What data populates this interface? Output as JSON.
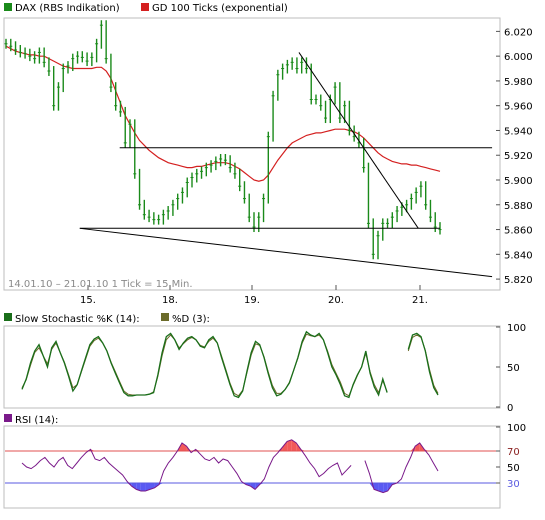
{
  "legend": {
    "price_label": "DAX (RBS Indikation)",
    "ma_label": "GD 100 Ticks (exponential)",
    "price_color": "#1a8a1a",
    "ma_color": "#d42020",
    "stoch_k_label": "Slow Stochastic %K (14):",
    "stoch_d_label": "%D (3):",
    "stoch_k_color": "#1a6e1a",
    "stoch_d_color": "#6b6b2a",
    "rsi_label": "RSI (14):",
    "rsi_color": "#7a1a8a"
  },
  "period_note": "14.01.10 – 21.01.10   1 Tick = 15 Min.",
  "chart_data": [
    {
      "type": "line",
      "title": "",
      "series": [
        {
          "name": "DAX (RBS Indikation)",
          "style": "bar-ticks",
          "values": [
            6010,
            6008,
            6005,
            6003,
            6002,
            6000,
            5998,
            6003,
            5995,
            5988,
            5960,
            5975,
            5990,
            5992,
            5998,
            6000,
            5999,
            5996,
            5999,
            6010,
            6025,
            5998,
            5975,
            5960,
            5955,
            5930,
            5945,
            5905,
            5880,
            5872,
            5870,
            5868,
            5868,
            5872,
            5875,
            5880,
            5885,
            5890,
            5898,
            5902,
            5905,
            5907,
            5910,
            5912,
            5915,
            5917,
            5916,
            5910,
            5905,
            5895,
            5885,
            5870,
            5862,
            5870,
            5885,
            5935,
            5968,
            5985,
            5990,
            5993,
            5995,
            5990,
            5995,
            5990,
            5965,
            5965,
            5960,
            5950,
            5965,
            5975,
            5950,
            5960,
            5940,
            5935,
            5930,
            5910,
            5865,
            5840,
            5855,
            5865,
            5865,
            5870,
            5875,
            5878,
            5880,
            5885,
            5890,
            5895,
            5880,
            5870,
            5862,
            5860
          ],
          "ylim": [
            5812,
            6030
          ]
        },
        {
          "name": "GD 100 Ticks (exponential)",
          "style": "line",
          "values": [
            6008,
            6006,
            6004,
            6003,
            6002,
            6001,
            6001,
            6000,
            6000,
            5998,
            5996,
            5994,
            5992,
            5991,
            5990,
            5990,
            5990,
            5990,
            5990,
            5991,
            5991,
            5988,
            5982,
            5972,
            5962,
            5952,
            5945,
            5938,
            5932,
            5928,
            5924,
            5921,
            5918,
            5916,
            5914,
            5913,
            5912,
            5911,
            5910,
            5910,
            5911,
            5911,
            5912,
            5913,
            5914,
            5914,
            5914,
            5913,
            5911,
            5909,
            5906,
            5903,
            5900,
            5899,
            5900,
            5904,
            5910,
            5916,
            5921,
            5926,
            5930,
            5932,
            5934,
            5936,
            5937,
            5938,
            5938,
            5939,
            5940,
            5941,
            5941,
            5941,
            5940,
            5939,
            5937,
            5934,
            5930,
            5926,
            5922,
            5919,
            5917,
            5915,
            5914,
            5913,
            5913,
            5912,
            5912,
            5911,
            5910,
            5909,
            5908,
            5907
          ]
        }
      ],
      "trendlines": [
        {
          "from": [
            0.17,
            5861
          ],
          "to": [
            1.12,
            5822
          ]
        },
        {
          "from": [
            0.17,
            5861
          ],
          "to": [
            1.0,
            5861
          ]
        },
        {
          "from": [
            0.262,
            5926
          ],
          "to": [
            1.12,
            5926
          ]
        },
        {
          "from": [
            0.675,
            6003
          ],
          "to": [
            0.95,
            5861
          ]
        }
      ],
      "x_ticks": [
        "15.",
        "18.",
        "19.",
        "20.",
        "21."
      ],
      "y_ticks": [
        5820,
        5840,
        5860,
        5880,
        5900,
        5920,
        5940,
        5960,
        5980,
        6000,
        6020
      ],
      "y_tick_labels": [
        "5.820",
        "5.840",
        "5.860",
        "5.880",
        "5.900",
        "5.920",
        "5.940",
        "5.960",
        "5.980",
        "6.000",
        "6.020"
      ],
      "ylim": [
        5812,
        6030
      ],
      "grid": false
    },
    {
      "type": "line",
      "series": [
        {
          "name": "Slow Stochastic %K (14):",
          "values": [
            22,
            35,
            55,
            70,
            78,
            64,
            50,
            74,
            82,
            68,
            55,
            38,
            20,
            28,
            45,
            62,
            78,
            85,
            88,
            80,
            70,
            55,
            42,
            30,
            18,
            14,
            14,
            15,
            15,
            15,
            16,
            18,
            40,
            68,
            88,
            92,
            84,
            72,
            80,
            86,
            88,
            84,
            76,
            74,
            84,
            88,
            80,
            62,
            45,
            28,
            14,
            12,
            20,
            45,
            68,
            82,
            78,
            62,
            42,
            24,
            14,
            16,
            22,
            30,
            46,
            62,
            82,
            94,
            90,
            88,
            92,
            84,
            68,
            50,
            40,
            28,
            14,
            12,
            28,
            40,
            50,
            70,
            42,
            25,
            15,
            35,
            18,
            12,
            18,
            32,
            45,
            72,
            90,
            92,
            88,
            70,
            44,
            24,
            15
          ],
          "gaps": [
            87,
            88,
            89,
            90
          ]
        },
        {
          "name": "%D (3):",
          "values": [
            24,
            34,
            52,
            68,
            74,
            64,
            54,
            72,
            80,
            68,
            56,
            40,
            24,
            28,
            44,
            60,
            76,
            83,
            86,
            80,
            70,
            56,
            44,
            32,
            20,
            16,
            15,
            15,
            15,
            15,
            16,
            19,
            38,
            64,
            84,
            90,
            84,
            74,
            79,
            84,
            87,
            84,
            77,
            75,
            82,
            86,
            80,
            64,
            47,
            30,
            17,
            14,
            21,
            43,
            65,
            79,
            77,
            63,
            44,
            27,
            17,
            17,
            22,
            31,
            46,
            61,
            80,
            91,
            89,
            88,
            90,
            84,
            70,
            53,
            42,
            31,
            17,
            14,
            27,
            39,
            50,
            67,
            44,
            28,
            18,
            33,
            19,
            14,
            19,
            32,
            45,
            70,
            87,
            90,
            87,
            71,
            47,
            27,
            17
          ],
          "gaps": [
            87,
            88,
            89,
            90
          ]
        }
      ],
      "y_ticks": [
        0,
        50,
        100
      ],
      "ylim": [
        0,
        100
      ],
      "grid": false
    },
    {
      "type": "line",
      "series": [
        {
          "name": "RSI (14):",
          "values": [
            55,
            50,
            48,
            52,
            58,
            62,
            55,
            50,
            58,
            62,
            52,
            48,
            55,
            62,
            68,
            72,
            60,
            58,
            62,
            55,
            50,
            45,
            40,
            32,
            26,
            22,
            20,
            20,
            22,
            24,
            28,
            45,
            55,
            62,
            70,
            80,
            76,
            68,
            72,
            66,
            60,
            58,
            62,
            55,
            60,
            58,
            50,
            42,
            32,
            28,
            26,
            22,
            28,
            35,
            50,
            62,
            68,
            75,
            82,
            84,
            80,
            72,
            64,
            55,
            48,
            38,
            42,
            48,
            52,
            55,
            40,
            46,
            52,
            48,
            56,
            58,
            42,
            22,
            20,
            18,
            20,
            28,
            30,
            35,
            50,
            62,
            76,
            80,
            72,
            65,
            55,
            45
          ],
          "gaps": [
            73,
            74
          ]
        }
      ],
      "reference_lines": [
        {
          "value": 70,
          "color": "#e05050"
        },
        {
          "value": 30,
          "color": "#5a5ae0"
        }
      ],
      "fill_colors": {
        "above": "#f25a5a",
        "below": "#5a5af2"
      },
      "y_ticks": [
        30,
        50,
        70,
        100
      ],
      "ylim": [
        0,
        100
      ],
      "grid": false
    }
  ]
}
